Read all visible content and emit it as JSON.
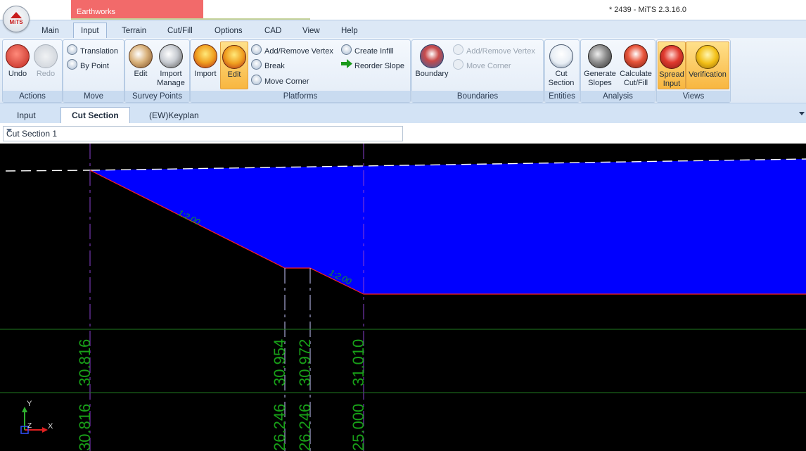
{
  "app": {
    "logo_text": "MiTS",
    "context_tab": "Earthworks",
    "window_title": "* 2439 - MiTS 2.3.16.0"
  },
  "ribbon_tabs": [
    "Main",
    "Input",
    "Terrain",
    "Cut/Fill",
    "Options",
    "CAD",
    "View",
    "Help"
  ],
  "active_ribbon_tab": "Input",
  "groups": {
    "actions": {
      "label": "Actions",
      "undo": "Undo",
      "redo": "Redo"
    },
    "move": {
      "label": "Move",
      "translation": "Translation",
      "by_point": "By Point"
    },
    "survey_points": {
      "label": "Survey Points",
      "edit": "Edit",
      "import_manage_1": "Import",
      "import_manage_2": "Manage"
    },
    "platforms": {
      "label": "Platforms",
      "import": "Import",
      "edit": "Edit",
      "add_remove_vertex": "Add/Remove Vertex",
      "break": "Break",
      "move_corner": "Move Corner",
      "create_infill": "Create Infill",
      "reorder_slope": "Reorder Slope"
    },
    "boundaries": {
      "label": "Boundaries",
      "boundary": "Boundary",
      "add_remove_vertex": "Add/Remove Vertex",
      "move_corner": "Move Corner"
    },
    "entities": {
      "label": "Entities",
      "cut_section_1": "Cut",
      "cut_section_2": "Section"
    },
    "analysis": {
      "label": "Analysis",
      "generate_1": "Generate",
      "generate_2": "Slopes",
      "calc_1": "Calculate",
      "calc_2": "Cut/Fill"
    },
    "views": {
      "label": "Views",
      "spread_1": "Spread",
      "spread_2": "Input",
      "verification": "Verification"
    }
  },
  "doc_tabs": [
    "Input",
    "Cut Section",
    "(EW)Keyplan"
  ],
  "active_doc_tab": "Cut Section",
  "section_select": {
    "value": "Cut Section 1"
  },
  "canvas": {
    "slope_labels": [
      "1:2.00",
      "1:2.00"
    ],
    "station_labels": [
      "30.816",
      "30.954",
      "30.972",
      "31.010"
    ],
    "offset_labels": [
      "30.816",
      "26.246",
      "26.246",
      "25.000"
    ],
    "axis": {
      "y": "Y",
      "x": "X",
      "z": "Z"
    },
    "colors": {
      "fill": "#0000ff",
      "edge": "#ff0000",
      "guide": "#8a3fd0",
      "label": "#18a018",
      "grid": "#1f7a1f"
    }
  }
}
